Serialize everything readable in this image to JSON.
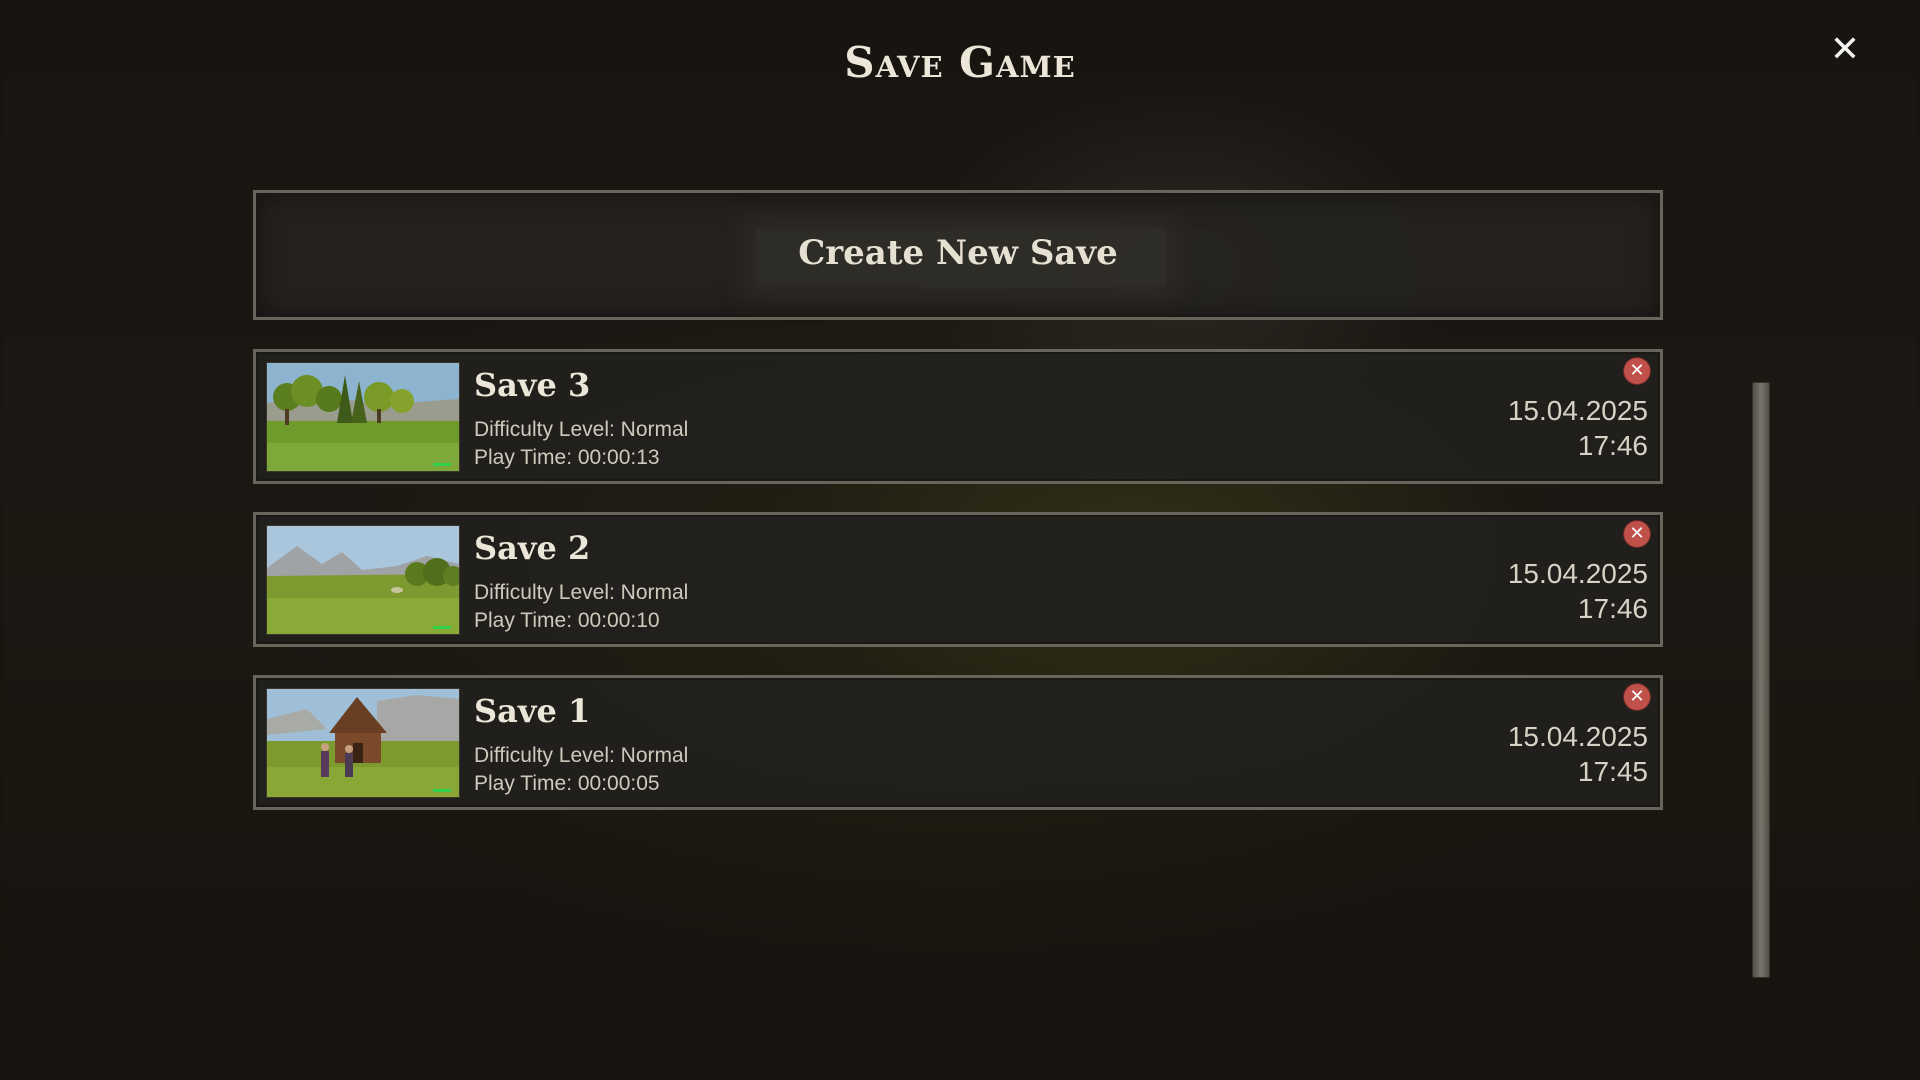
{
  "title": "Save Game",
  "create_button": "Create New Save",
  "saves": [
    {
      "name": "Save 3",
      "difficulty": "Difficulty Level: Normal",
      "playtime": "Play Time: 00:00:13",
      "date": "15.04.2025",
      "time": "17:46"
    },
    {
      "name": "Save 2",
      "difficulty": "Difficulty Level: Normal",
      "playtime": "Play Time: 00:00:10",
      "date": "15.04.2025",
      "time": "17:46"
    },
    {
      "name": "Save 1",
      "difficulty": "Difficulty Level: Normal",
      "playtime": "Play Time: 00:00:05",
      "date": "15.04.2025",
      "time": "17:45"
    }
  ],
  "icons": {
    "close": "close-icon",
    "delete": "delete-save-icon"
  },
  "colors": {
    "delete": "#c0504a",
    "border": "#6a655c",
    "panel": "#21201d"
  }
}
